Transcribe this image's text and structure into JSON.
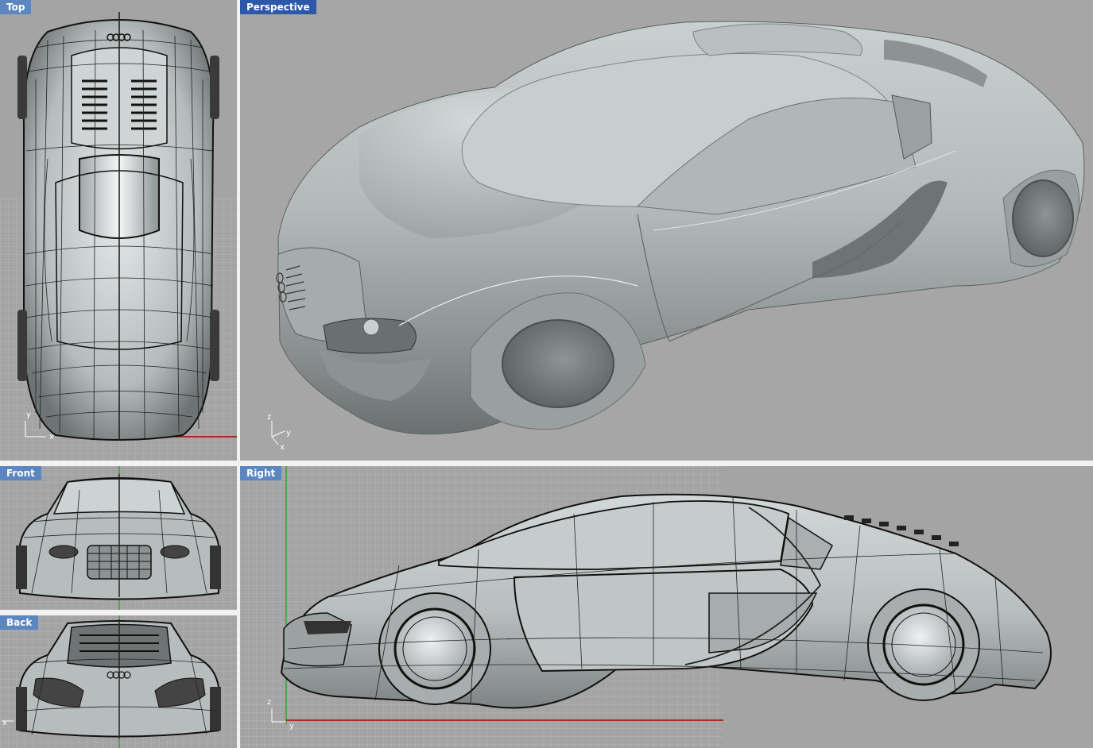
{
  "colors": {
    "viewport_bg": "#a4a4a4",
    "grid_line": "#b4b4b4",
    "tab_bg": "#5b86c0",
    "tab_active_bg": "#2d57a8",
    "tab_text": "#ffffff",
    "x_axis": "#b00000",
    "y_axis": "#00a000",
    "frame": "#f2f2f2",
    "body_surface": "#c4caca",
    "mesh_lines": "#111111"
  },
  "viewports": {
    "top": {
      "title": "Top",
      "axes": [
        "y",
        "x"
      ]
    },
    "perspective": {
      "title": "Perspective",
      "axes": [
        "z",
        "y",
        "x"
      ],
      "active": true
    },
    "front": {
      "title": "Front"
    },
    "back": {
      "title": "Back",
      "axes": [
        "x"
      ]
    },
    "right": {
      "title": "Right",
      "axes": [
        "z",
        "y"
      ]
    }
  }
}
